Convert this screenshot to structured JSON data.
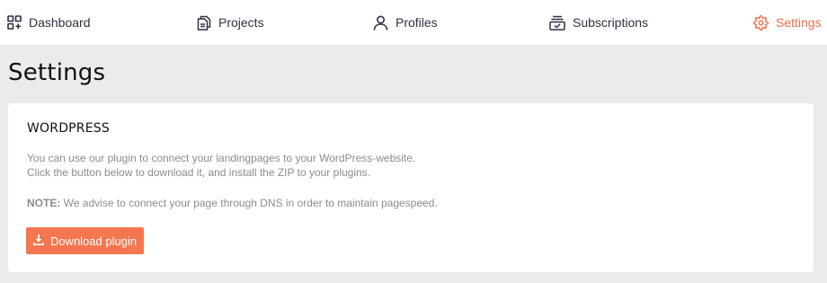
{
  "nav": {
    "items": [
      {
        "label": "Dashboard",
        "icon": "dashboard-grid-icon"
      },
      {
        "label": "Projects",
        "icon": "documents-icon"
      },
      {
        "label": "Profiles",
        "icon": "user-icon"
      },
      {
        "label": "Subscriptions",
        "icon": "subscriptions-icon"
      },
      {
        "label": "Settings",
        "icon": "gear-icon",
        "active": true
      }
    ],
    "active_color": "#f26b4a",
    "text_color": "#2d3142"
  },
  "page": {
    "title": "Settings"
  },
  "wordpress_card": {
    "title": "WORDPRESS",
    "description_line1": "You can use our plugin to connect your landingpages to your WordPress-website.",
    "description_line2": "Click the button below to download it, and install the ZIP to your plugins.",
    "note_label": "NOTE:",
    "note_text": " We advise to connect your page through DNS in order to maintain pagespeed.",
    "download_button_label": "Download plugin",
    "download_icon": "download-icon",
    "button_color": "#f4774f"
  }
}
